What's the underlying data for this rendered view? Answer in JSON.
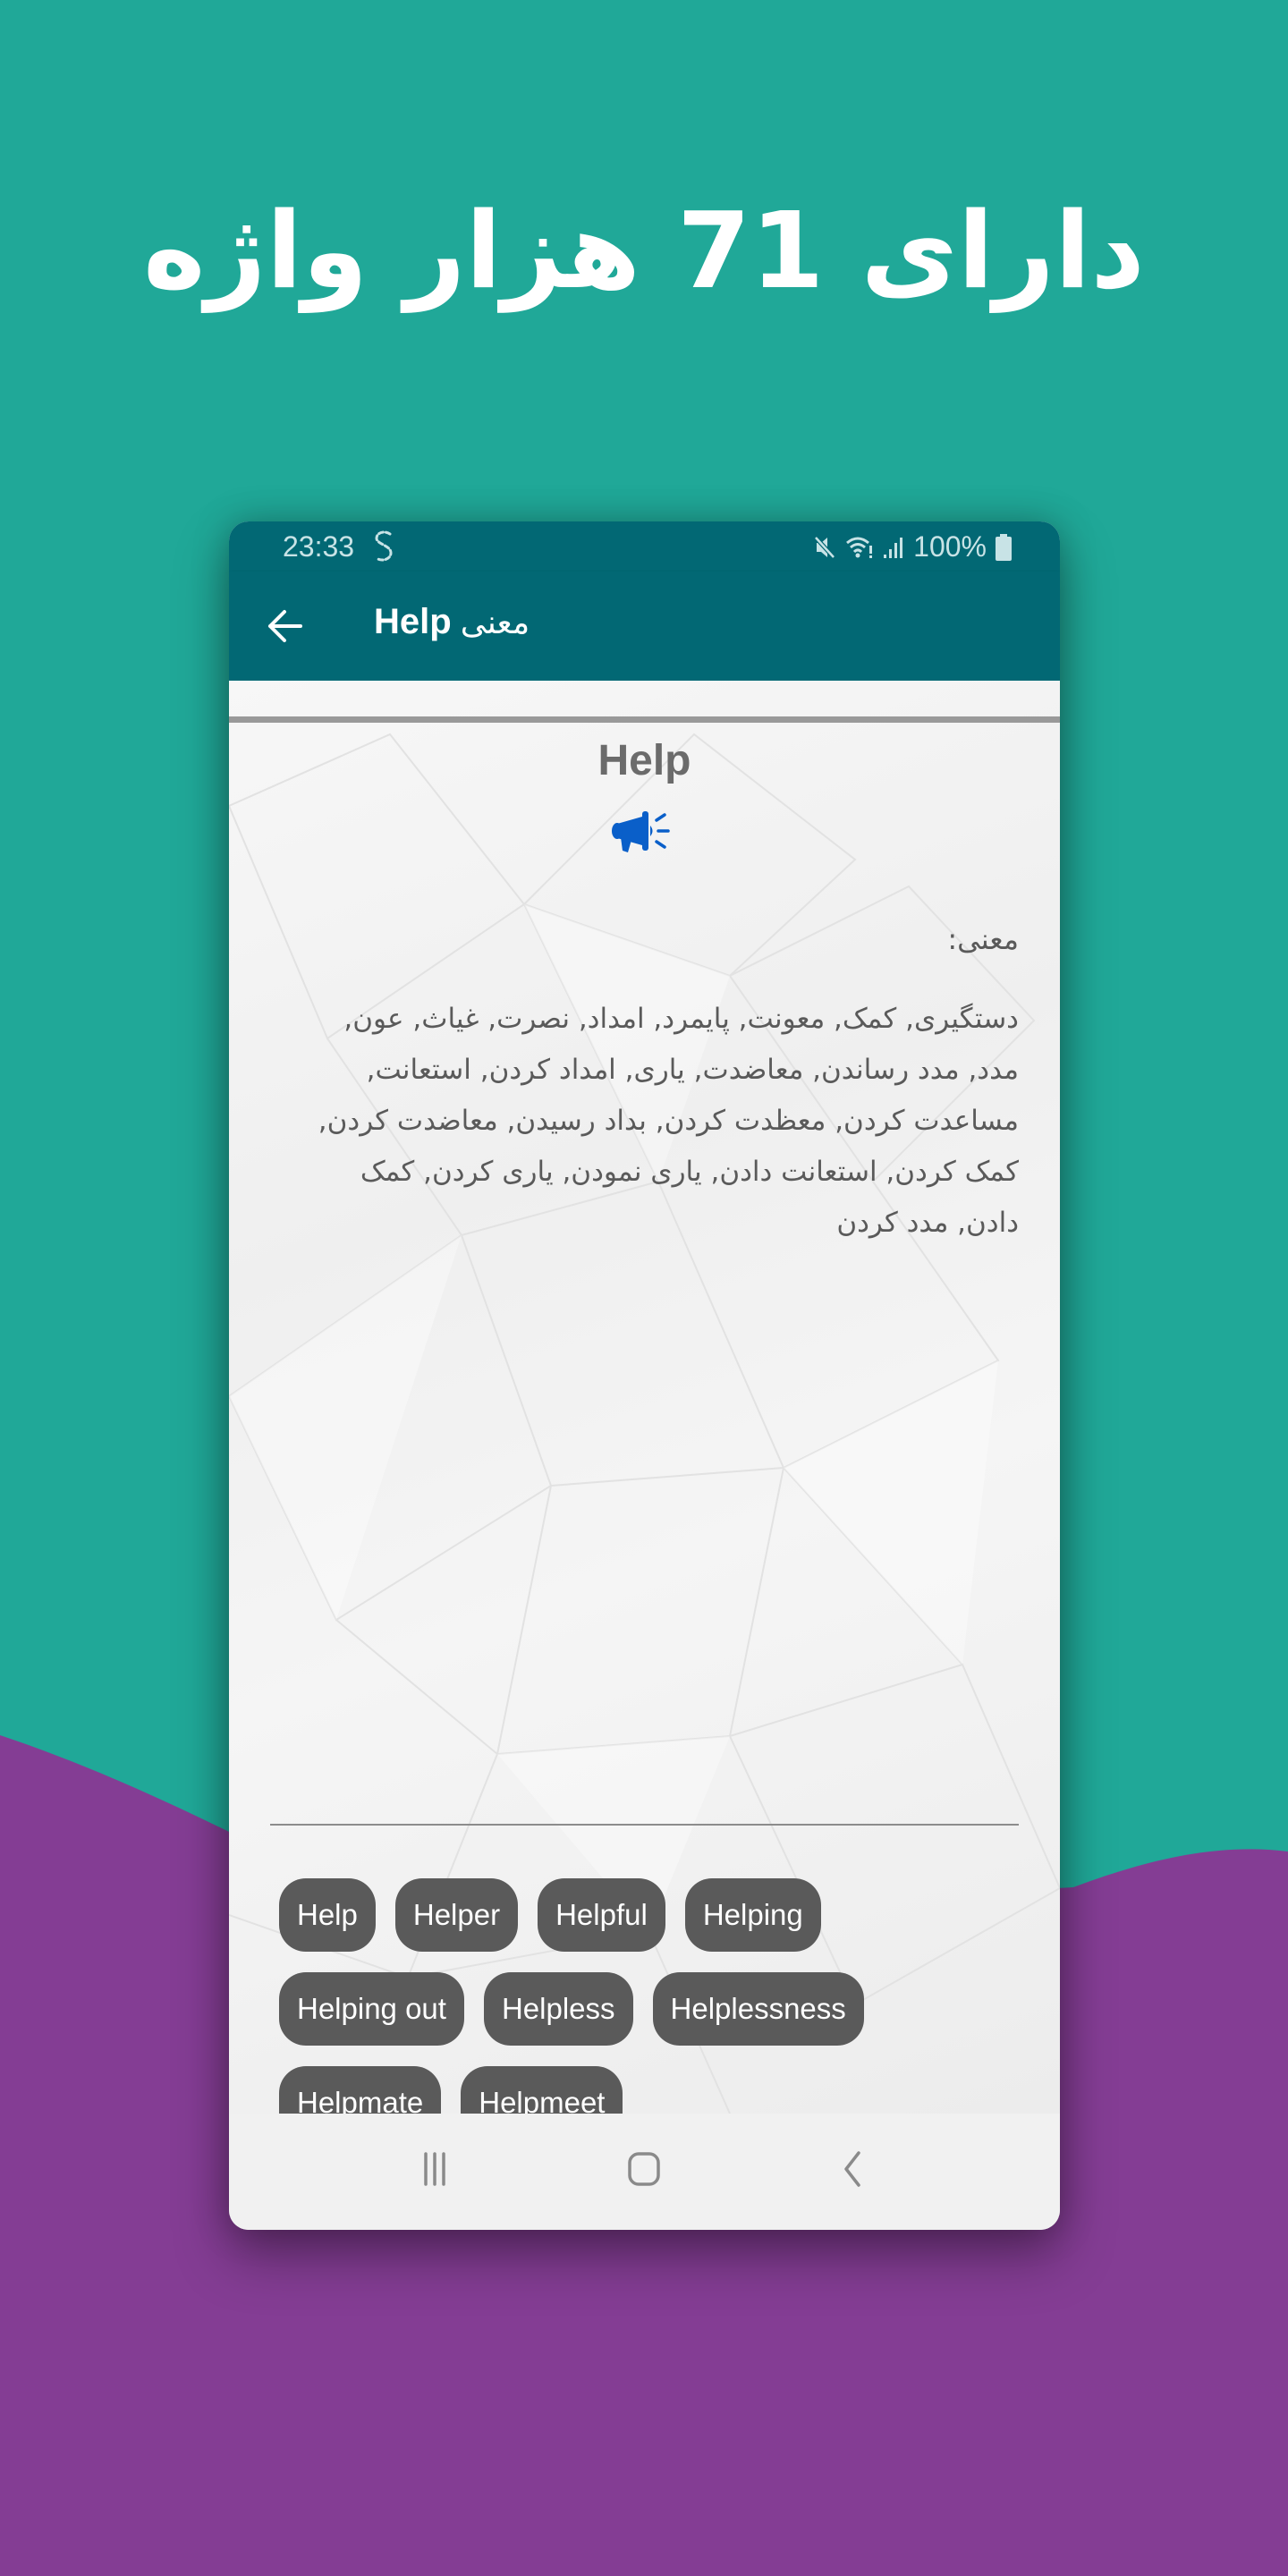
{
  "headline": "دارای 71 هزار واژه",
  "colors": {
    "teal_background": "#20a898",
    "purple_wave": "#843d94",
    "app_bar": "#026874",
    "chip_background": "#5a5a5a",
    "speaker_icon": "#0a5fc9"
  },
  "status_bar": {
    "time": "23:33",
    "battery": "100%",
    "icons": [
      "speedify-s-icon",
      "mute-icon",
      "wifi-icon",
      "signal-icon",
      "battery-icon"
    ]
  },
  "app_bar": {
    "title_word": "Help",
    "title_prefix": "معنی",
    "back_icon": "arrow-left-icon"
  },
  "entry": {
    "word": "Help",
    "pronounce_icon": "megaphone-icon",
    "meaning_label": "معنی:",
    "meaning_text": "دستگیری, کمک, معونت, پایمرد, امداد, نصرت, غیاث, عون, مدد, مدد رساندن, معاضدت, یاری, امداد کردن, استعانت, مساعدت کردن, معظدت کردن, بداد رسیدن, معاضدت کردن, کمک کردن, استعانت دادن, یاری نمودن, یاری کردن, کمک دادن, مدد کردن"
  },
  "related_words": [
    "Help",
    "Helper",
    "Helpful",
    "Helping",
    "Helping out",
    "Helpless",
    "Helplessness",
    "Helpmate",
    "Helpmeet"
  ],
  "nav_bar": {
    "icons": [
      "recent-apps-icon",
      "home-icon",
      "back-icon"
    ]
  }
}
